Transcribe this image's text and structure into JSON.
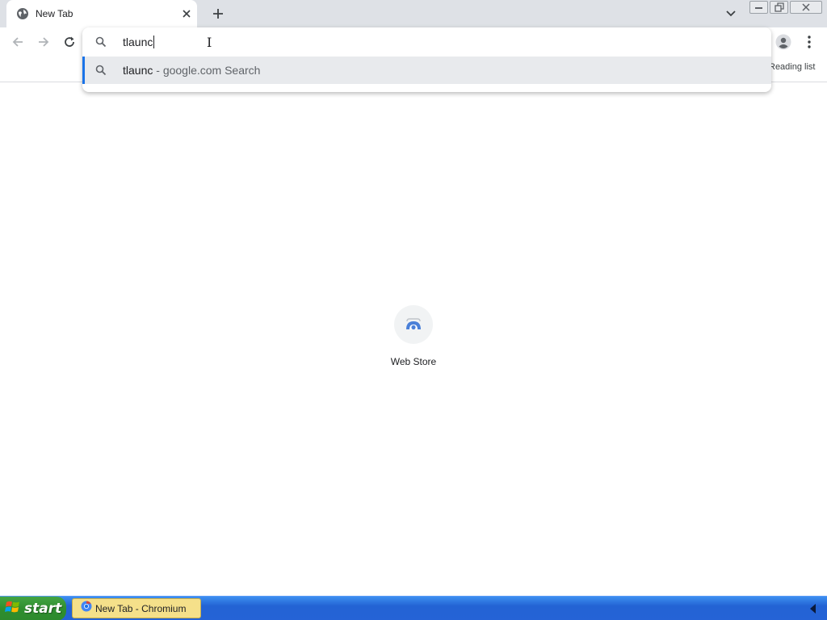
{
  "browser": {
    "tab": {
      "title": "New Tab",
      "favicon": "globe-icon"
    },
    "window_controls": [
      "minimize-icon",
      "restore-icon",
      "close-icon"
    ]
  },
  "omnibox": {
    "input_value": "tlaunc",
    "suggestions": [
      {
        "query": "tlaunc",
        "separator": " - ",
        "description": "google.com Search",
        "icon": "search-icon"
      }
    ]
  },
  "bookmarks_bar": {
    "reading_list_label": "Reading list"
  },
  "content": {
    "shortcuts": [
      {
        "label": "Web Store",
        "icon": "web-store-icon"
      }
    ]
  },
  "taskbar": {
    "start_label": "start",
    "items": [
      {
        "label": "New Tab - Chromium",
        "icon": "chromium-icon"
      }
    ]
  },
  "colors": {
    "tab_strip": "#dee1e6",
    "selection_bar": "#1a73e8",
    "suggestion_highlight": "#e8eaed",
    "taskbar_blue": "#2563d6",
    "start_green": "#2f8e2f"
  }
}
